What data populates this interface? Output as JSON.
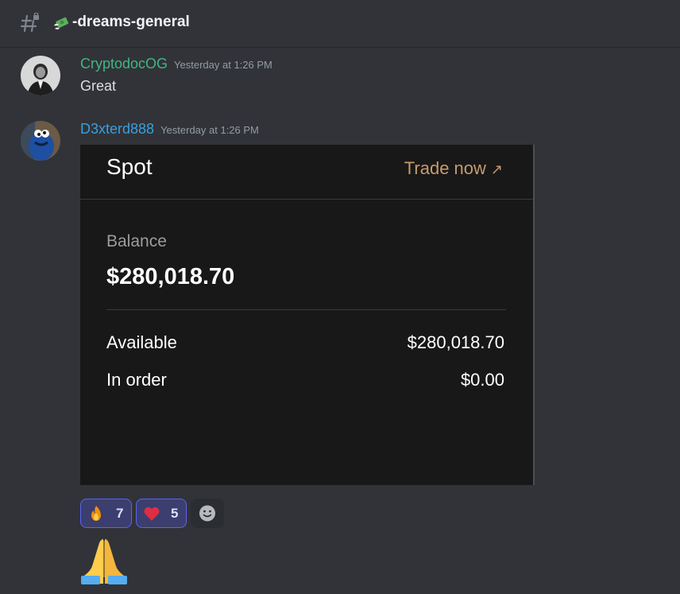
{
  "channel": {
    "name": "-dreams-general",
    "emoji": "money-with-wings-emoji"
  },
  "messages": [
    {
      "username": "CryptodocOG",
      "username_color": "#43b581",
      "timestamp": "Yesterday at 1:26 PM",
      "text": "Great"
    },
    {
      "username": "D3xterd888",
      "username_color": "#3a9fdd",
      "timestamp": "Yesterday at 1:26 PM",
      "card": {
        "title": "Spot",
        "trade_label": "Trade now",
        "trade_icon": "arrow-up-right-icon",
        "balance_label": "Balance",
        "balance_value": "$280,018.70",
        "rows": [
          {
            "label": "Available",
            "value": "$280,018.70"
          },
          {
            "label": "In order",
            "value": "$0.00"
          }
        ]
      },
      "reactions": [
        {
          "emoji": "fire-emoji",
          "count": "7"
        },
        {
          "emoji": "heart-emoji",
          "count": "5"
        }
      ],
      "add_reaction_icon": "smiley-add-icon"
    }
  ],
  "follow_up_emoji": "folded-hands-emoji",
  "colors": {
    "background": "#313338",
    "card_bg": "#181818",
    "accent_trade": "#c89a6c",
    "reaction_bg": "#3b3e6e",
    "reaction_border": "#5865f2"
  }
}
